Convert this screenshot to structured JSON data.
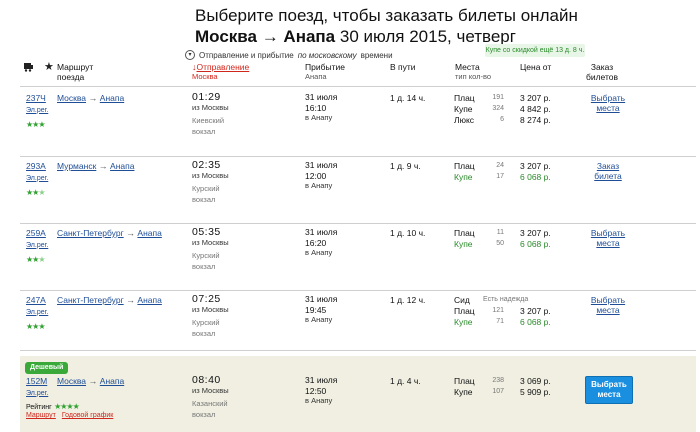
{
  "header": {
    "title_line1": "Выберите поезд, чтобы заказать билеты онлайн",
    "title_route": "Москва → Анапа",
    "title_date": " 30 июля 2015, четверг",
    "subnote_prefix": "Отправление и прибытие ",
    "subnote_em": "по московскому",
    "subnote_suffix": " времени",
    "discount": "Купе со скидкой ещё 13 д. 8 ч."
  },
  "columns": {
    "route": "Маршрут",
    "route_sub": "поезда",
    "departure": "Отправление",
    "departure_sub": "Москва",
    "arrival": "Прибытие",
    "arrival_sub": "Анапа",
    "travel": "В пути",
    "seats": "Места",
    "seats_sub": "тип кол-во",
    "price": "Цена от",
    "order": "Заказ",
    "order_sub": "билетов"
  },
  "trains": [
    {
      "number": "237Ч",
      "type": "Эл.рег.",
      "from": "Москва",
      "to": "Анапа",
      "dep_time": "01:29",
      "dep_place": "из Москвы",
      "dep_station1": "Киевский",
      "dep_station2": "вокзал",
      "arr_date": "31 июля",
      "arr_time": "16:10",
      "arr_place": "в Анапу",
      "travel": "1 д. 14 ч.",
      "seats": [
        {
          "type": "Плац",
          "count": "191",
          "price": "3 207 р."
        },
        {
          "type": "Купе",
          "count": "324",
          "price": "4 842 р."
        },
        {
          "type": "Люкс",
          "count": "6",
          "price": "8 274 р."
        }
      ],
      "choose1": "Выбрать",
      "choose2": "места"
    },
    {
      "number": "293А",
      "type": "Эл.рег.",
      "from": "Мурманск",
      "to": "Анапа",
      "dep_time": "02:35",
      "dep_place": "из Москвы",
      "dep_station1": "Курский",
      "dep_station2": "вокзал",
      "arr_date": "31 июля",
      "arr_time": "12:00",
      "arr_place": "в Анапу",
      "travel": "1 д. 9 ч.",
      "seats": [
        {
          "type": "Плац",
          "count": "24",
          "price": "3 207 р."
        },
        {
          "type": "Купе",
          "count": "17",
          "price": "6 068 р."
        }
      ],
      "choose1": "Заказ",
      "choose2": "билета"
    },
    {
      "number": "259А",
      "type": "Эл.рег.",
      "from": "Санкт-Петербург",
      "to": "Анапа",
      "dep_time": "05:35",
      "dep_place": "из Москвы",
      "dep_station1": "Курский",
      "dep_station2": "вокзал",
      "arr_date": "31 июля",
      "arr_time": "16:20",
      "arr_place": "в Анапу",
      "travel": "1 д. 10 ч.",
      "seats": [
        {
          "type": "Плац",
          "count": "11",
          "price": "3 207 р."
        },
        {
          "type": "Купе",
          "count": "50",
          "price": "6 068 р."
        }
      ],
      "choose1": "Выбрать",
      "choose2": "места"
    },
    {
      "number": "247А",
      "type": "Эл.рег.",
      "from": "Санкт-Петербург",
      "to": "Анапа",
      "dep_time": "07:25",
      "dep_place": "из Москвы",
      "dep_station1": "Курский",
      "dep_station2": "вокзал",
      "arr_date": "31 июля",
      "arr_time": "19:45",
      "arr_place": "в Анапу",
      "travel": "1 д. 12 ч.",
      "seats": [
        {
          "type": "Сид",
          "count": "",
          "note": "Есть надежда",
          "price": ""
        },
        {
          "type": "Плац",
          "count": "121",
          "price": "3 207 р."
        },
        {
          "type": "Купе",
          "count": "71",
          "price": "6 068 р."
        }
      ],
      "choose1": "Выбрать",
      "choose2": "места"
    },
    {
      "badge": "Дешевый",
      "number": "152М",
      "type": "Эл.рег.",
      "from": "Москва",
      "to": "Анапа",
      "rating_label": "Рейтинг",
      "dep_time": "08:40",
      "dep_place": "из Москвы",
      "dep_station1": "Казанский",
      "dep_station2": "вокзал",
      "arr_date": "31 июля",
      "arr_time": "12:50",
      "arr_place": "в Анапу",
      "travel": "1 д. 4 ч.",
      "seats": [
        {
          "type": "Плац",
          "count": "238",
          "price": "3 069 р."
        },
        {
          "type": "Купе",
          "count": "107",
          "price": "5 909 р."
        }
      ],
      "choose1": "Выбрать",
      "choose2": "места",
      "link_route": "Маршрут",
      "link_schedule": "Годовой график"
    }
  ],
  "colors": {
    "link": "#1f4e96",
    "accent_red": "#d0271d",
    "green": "#2a8a2a",
    "button": "#1a8fe0",
    "cheap_bg": "#f0efe2"
  }
}
